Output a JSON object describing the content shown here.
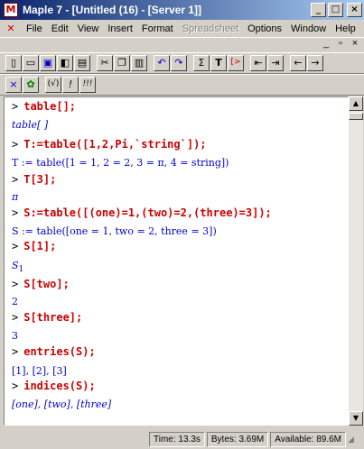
{
  "window": {
    "title": "Maple 7 - [Untitled (16) - [Server 1]]",
    "minimize": "_",
    "maximize": "□",
    "close": "×"
  },
  "menu": {
    "items": [
      {
        "label": "File",
        "disabled": false
      },
      {
        "label": "Edit",
        "disabled": false
      },
      {
        "label": "View",
        "disabled": false
      },
      {
        "label": "Insert",
        "disabled": false
      },
      {
        "label": "Format",
        "disabled": false
      },
      {
        "label": "Spreadsheet",
        "disabled": true
      },
      {
        "label": "Options",
        "disabled": false
      },
      {
        "label": "Window",
        "disabled": false
      },
      {
        "label": "Help",
        "disabled": false
      }
    ],
    "doc_minimize": "_",
    "doc_restore": "▫",
    "doc_close": "×"
  },
  "toolbar1": {
    "sigma": "Σ",
    "text": "T",
    "bracket": "[>"
  },
  "toolbar2": {
    "restart": "(√)",
    "stop": "!",
    "execute_all": "!!!"
  },
  "worksheet": {
    "prompt": ">",
    "lines": [
      {
        "kind": "cmd",
        "text": "table[];"
      },
      {
        "kind": "out",
        "text": "table[ ]"
      },
      {
        "kind": "cmd",
        "text": "T:=table([1,2,Pi,`string`]);"
      },
      {
        "kind": "out",
        "text": "T := table([1 = 1, 2 = 2, 3 = π, 4 = string])"
      },
      {
        "kind": "cmd",
        "text": "T[3];"
      },
      {
        "kind": "out",
        "text": "π"
      },
      {
        "kind": "cmd",
        "text": "S:=table([(one)=1,(two)=2,(three)=3]);"
      },
      {
        "kind": "out",
        "text": "S := table([one = 1, two = 2, three = 3])"
      },
      {
        "kind": "cmd",
        "text": "S[1];"
      },
      {
        "kind": "out",
        "text": "S"
      },
      {
        "kind": "cmd",
        "text": "S[two];"
      },
      {
        "kind": "out",
        "text": "2"
      },
      {
        "kind": "cmd",
        "text": "S[three];"
      },
      {
        "kind": "out",
        "text": "3"
      },
      {
        "kind": "cmd",
        "text": "entries(S);"
      },
      {
        "kind": "out",
        "text": "[1], [2], [3]"
      },
      {
        "kind": "cmd",
        "text": "indices(S);"
      },
      {
        "kind": "out",
        "text": "[one], [two], [three]"
      }
    ],
    "s1_subscript": "1"
  },
  "status": {
    "time": "Time: 13.3s",
    "bytes": "Bytes: 3.69M",
    "available": "Available: 89.6M"
  }
}
